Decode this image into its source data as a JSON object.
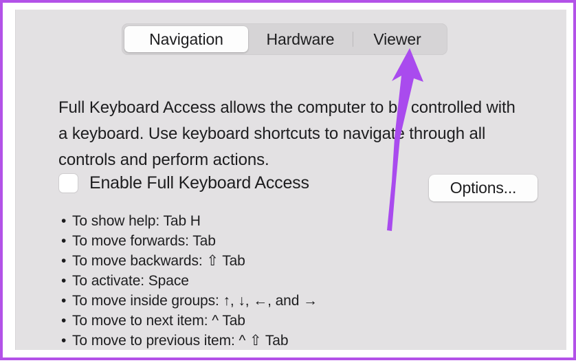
{
  "window": {
    "tabs": [
      {
        "label": "Navigation",
        "selected": true
      },
      {
        "label": "Hardware",
        "selected": false
      },
      {
        "label": "Viewer",
        "selected": false
      }
    ]
  },
  "main": {
    "description": "Full Keyboard Access allows the computer to be controlled with a keyboard. Use keyboard shortcuts to navigate through all controls and perform actions.",
    "checkbox": {
      "label": "Enable Full Keyboard Access",
      "checked": false
    },
    "options_button_label": "Options...",
    "shortcuts": [
      "To show help: Tab H",
      "To move forwards: Tab",
      "To move backwards: ⇧ Tab",
      "To activate: Space",
      "To move inside groups: ↑, ↓, ←, and →",
      "To move to next item: ^ Tab",
      "To move to previous item: ^ ⇧ Tab"
    ]
  },
  "annotation": {
    "arrow_color": "#a94bee",
    "frame_color": "#b352e8",
    "points_to": "Viewer"
  },
  "colors": {
    "panel_background": "#e3e1e3",
    "tab_track": "#d6d4d6",
    "selected_tab": "#fdfdfd",
    "text": "#1d1d1f"
  }
}
